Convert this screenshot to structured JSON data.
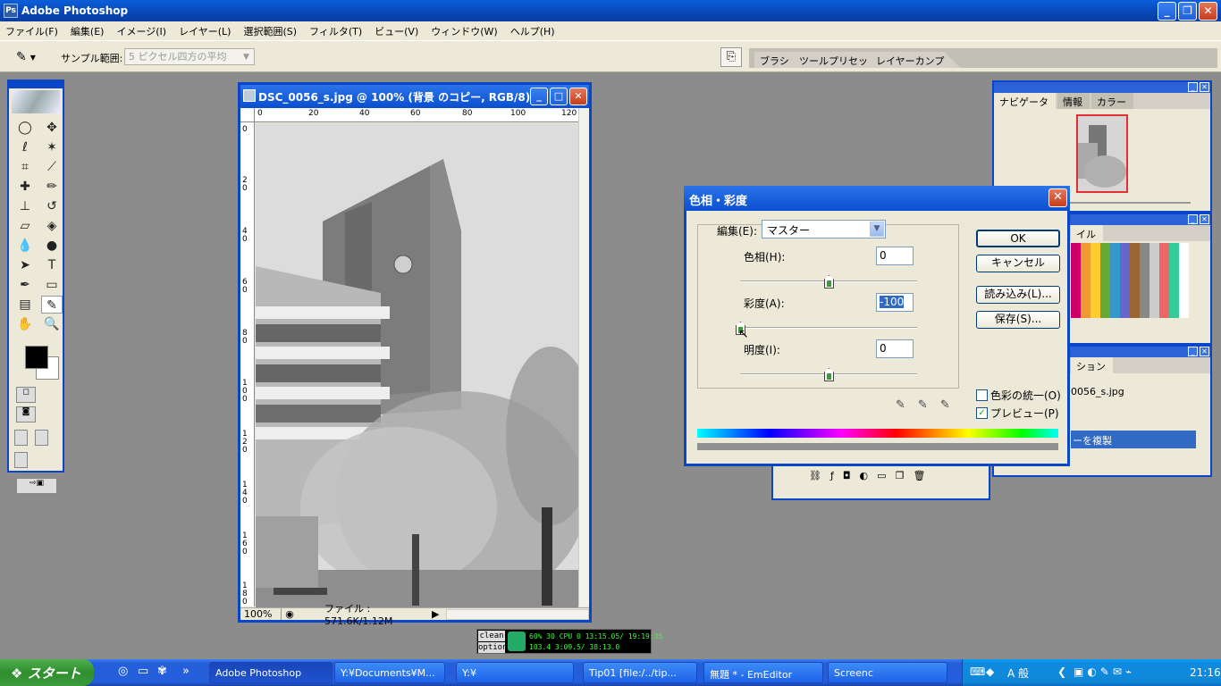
{
  "app": {
    "title": "Adobe Photoshop"
  },
  "menu": [
    "ファイル(F)",
    "編集(E)",
    "イメージ(I)",
    "レイヤー(L)",
    "選択範囲(S)",
    "フィルタ(T)",
    "ビュー(V)",
    "ウィンドウ(W)",
    "ヘルプ(H)"
  ],
  "options": {
    "sample_label": "サンプル範囲:",
    "sample_value": "5 ピクセル四方の平均"
  },
  "well_tabs": [
    "ブラシ",
    "ツールプリセット",
    "レイヤーカンプ"
  ],
  "document": {
    "title": "DSC_0056_s.jpg @ 100% (背景 のコピー, RGB/8)",
    "ruler_h": [
      "0",
      "20",
      "40",
      "60",
      "80",
      "100",
      "120"
    ],
    "ruler_v": [
      "0",
      "2 0",
      "4 0",
      "6 0",
      "8 0",
      "1 0 0",
      "1 2 0",
      "1 4 0",
      "1 6 0",
      "1 8 0"
    ],
    "zoom": "100%",
    "file_info": "ファイル : 571.6K/1.12M"
  },
  "navigator": {
    "tabs": [
      "ナビゲータ",
      "情報",
      "カラー"
    ]
  },
  "swatches": {
    "tab": "イル"
  },
  "history": {
    "tab": "ション",
    "file": "0056_s.jpg",
    "step": "ーを複製"
  },
  "dialog": {
    "title": "色相・彩度",
    "edit_label": "編集(E):",
    "edit_value": "マスター",
    "hue_label": "色相(H):",
    "hue_value": "0",
    "hue_level": 0,
    "sat_label": "彩度(A):",
    "sat_value": "-100",
    "sat_level": -100,
    "light_label": "明度(I):",
    "light_value": "0",
    "light_level": 0,
    "ok": "OK",
    "cancel": "キャンセル",
    "load": "読み込み(L)...",
    "save": "保存(S)...",
    "colorize": "色彩の統一(O)",
    "preview": "プレビュー(P)",
    "preview_checked": true
  },
  "meter": {
    "clean": "clean",
    "option": "option",
    "line1": "60% 30 CPU  0 13:15.05/ 19:19:35",
    "line2": "103.4   3:09.5/  38:13.0"
  },
  "taskbar": {
    "start": "スタート",
    "tasks": [
      "Adobe Photoshop",
      "Y:¥Documents¥M...",
      "Y:¥",
      "Tip01 [file:/../tip...",
      "無題 * - EmEditor",
      "Screenc"
    ],
    "ime": "A 般",
    "clock": "21:16"
  }
}
